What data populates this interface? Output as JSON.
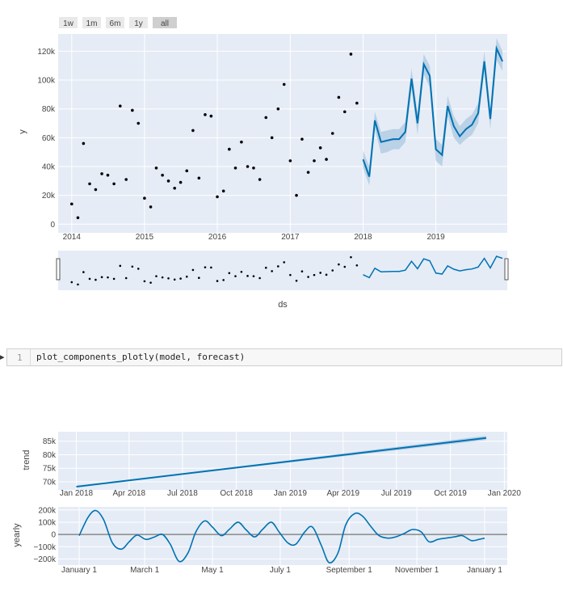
{
  "range_buttons": [
    {
      "label": "1w",
      "active": false
    },
    {
      "label": "1m",
      "active": false
    },
    {
      "label": "6m",
      "active": false
    },
    {
      "label": "1y",
      "active": false
    },
    {
      "label": "all",
      "active": true
    }
  ],
  "colors": {
    "plot_bg": "#e5ecf6",
    "forecast_line": "#0072b2",
    "band": "#b3cde3",
    "points": "#000000",
    "zero_line": "#888888",
    "button_bg": "#e9e9e9",
    "button_active_bg": "#cfcfcf"
  },
  "code_cell": {
    "line_number": "1",
    "code": "plot_components_plotly(model, forecast)",
    "prompt": "▸"
  },
  "chart_data": [
    {
      "type": "scatter",
      "title": "",
      "xlabel": "ds",
      "ylabel": "y",
      "ylim": [
        -6000,
        132000
      ],
      "x_ticks": [
        "2014",
        "2015",
        "2016",
        "2017",
        "2018",
        "2019"
      ],
      "y_ticks": [
        0,
        20000,
        40000,
        60000,
        80000,
        100000,
        120000
      ],
      "y_tick_labels": [
        "0",
        "20k",
        "40k",
        "60k",
        "80k",
        "100k",
        "120k"
      ],
      "range_slider": true,
      "series": [
        {
          "kind": "actual_points",
          "x": [
            "2014-01-01",
            "2014-02-01",
            "2014-03-01",
            "2014-04-01",
            "2014-05-01",
            "2014-06-01",
            "2014-07-01",
            "2014-08-01",
            "2014-09-01",
            "2014-10-01",
            "2014-11-01",
            "2014-12-01",
            "2015-01-01",
            "2015-02-01",
            "2015-03-01",
            "2015-04-01",
            "2015-05-01",
            "2015-06-01",
            "2015-07-01",
            "2015-08-01",
            "2015-09-01",
            "2015-10-01",
            "2015-11-01",
            "2015-12-01",
            "2016-01-01",
            "2016-02-01",
            "2016-03-01",
            "2016-04-01",
            "2016-05-01",
            "2016-06-01",
            "2016-07-01",
            "2016-08-01",
            "2016-09-01",
            "2016-10-01",
            "2016-11-01",
            "2016-12-01",
            "2017-01-01",
            "2017-02-01",
            "2017-03-01",
            "2017-04-01",
            "2017-05-01",
            "2017-06-01",
            "2017-07-01",
            "2017-08-01",
            "2017-09-01",
            "2017-10-01",
            "2017-11-01",
            "2017-12-01"
          ],
          "y": [
            14000,
            4500,
            56000,
            28000,
            24000,
            35000,
            34000,
            28000,
            82000,
            31000,
            79000,
            70000,
            18000,
            12000,
            39000,
            34000,
            30000,
            25000,
            29000,
            37000,
            65000,
            32000,
            76000,
            75000,
            19000,
            23000,
            52000,
            39000,
            57000,
            40000,
            39000,
            31000,
            74000,
            60000,
            80000,
            97000,
            44000,
            20000,
            59000,
            36000,
            44000,
            53000,
            45000,
            63000,
            88000,
            78000,
            118000,
            84000
          ]
        },
        {
          "kind": "forecast_line",
          "x": [
            "2018-01-01",
            "2018-02-01",
            "2018-03-01",
            "2018-04-01",
            "2018-05-01",
            "2018-06-01",
            "2018-07-01",
            "2018-08-01",
            "2018-09-01",
            "2018-10-01",
            "2018-11-01",
            "2018-12-01",
            "2019-01-01",
            "2019-02-01",
            "2019-03-01",
            "2019-04-01",
            "2019-05-01",
            "2019-06-01",
            "2019-07-01",
            "2019-08-01",
            "2019-09-01",
            "2019-10-01",
            "2019-11-01",
            "2019-12-01"
          ],
          "y": [
            45000,
            33000,
            72000,
            57000,
            58000,
            59000,
            59000,
            64000,
            101000,
            70000,
            111000,
            103000,
            52000,
            48000,
            82000,
            68000,
            61000,
            66000,
            69000,
            77000,
            113000,
            73000,
            122000,
            113000
          ],
          "lower": [
            39000,
            27000,
            66000,
            49000,
            50000,
            52000,
            52000,
            57000,
            94000,
            62000,
            104000,
            95000,
            44000,
            40000,
            75000,
            60000,
            55000,
            59000,
            62000,
            70000,
            106000,
            66000,
            114000,
            106000
          ],
          "upper": [
            51000,
            40000,
            78000,
            64000,
            65000,
            66000,
            66000,
            71000,
            108000,
            77000,
            118000,
            110000,
            59000,
            55000,
            89000,
            75000,
            68000,
            73000,
            76000,
            84000,
            120000,
            80000,
            129000,
            120000
          ]
        }
      ]
    },
    {
      "type": "line",
      "title": "",
      "ylabel": "trend",
      "ylim": [
        67000,
        88500
      ],
      "x_ticks": [
        "Jan 2018",
        "Apr 2018",
        "Jul 2018",
        "Oct 2018",
        "Jan 2019",
        "Apr 2019",
        "Jul 2019",
        "Oct 2019",
        "Jan 2020"
      ],
      "y_ticks": [
        70000,
        75000,
        80000,
        85000
      ],
      "y_tick_labels": [
        "70k",
        "75k",
        "80k",
        "85k"
      ],
      "series": [
        {
          "kind": "trend",
          "x": [
            "2018-01-01",
            "2019-12-01"
          ],
          "y": [
            68200,
            86200
          ],
          "lower": [
            68200,
            85400
          ],
          "upper": [
            68200,
            87000
          ]
        }
      ]
    },
    {
      "type": "line",
      "title": "",
      "ylabel": "yearly",
      "ylim": [
        -250000,
        225000
      ],
      "x_ticks": [
        "January 1",
        "March 1",
        "May 1",
        "July 1",
        "September 1",
        "November 1",
        "January 1"
      ],
      "y_ticks": [
        -200000,
        -100000,
        0,
        100000,
        200000
      ],
      "y_tick_labels": [
        "−200k",
        "−100k",
        "0",
        "100k",
        "200k"
      ],
      "series": [
        {
          "kind": "yearly",
          "x": [
            0,
            8,
            15,
            22,
            30,
            38,
            45,
            52,
            60,
            68,
            75,
            82,
            90,
            98,
            105,
            113,
            120,
            128,
            135,
            143,
            150,
            158,
            165,
            173,
            180,
            188,
            195,
            203,
            210,
            218,
            225,
            233,
            240,
            248,
            255,
            263,
            270,
            278,
            285,
            293,
            300,
            308,
            315,
            323,
            330,
            338,
            345,
            353,
            360,
            365
          ],
          "y": [
            -10000,
            140000,
            195000,
            120000,
            -70000,
            -120000,
            -60000,
            -5000,
            -40000,
            -20000,
            0,
            -80000,
            -220000,
            -150000,
            20000,
            110000,
            60000,
            -10000,
            40000,
            100000,
            40000,
            -20000,
            40000,
            100000,
            20000,
            -70000,
            -80000,
            20000,
            60000,
            -90000,
            -230000,
            -150000,
            80000,
            170000,
            150000,
            60000,
            -10000,
            -30000,
            -20000,
            10000,
            40000,
            20000,
            -60000,
            -40000,
            -30000,
            -20000,
            -10000,
            -50000,
            -40000,
            -30000
          ]
        }
      ]
    }
  ]
}
